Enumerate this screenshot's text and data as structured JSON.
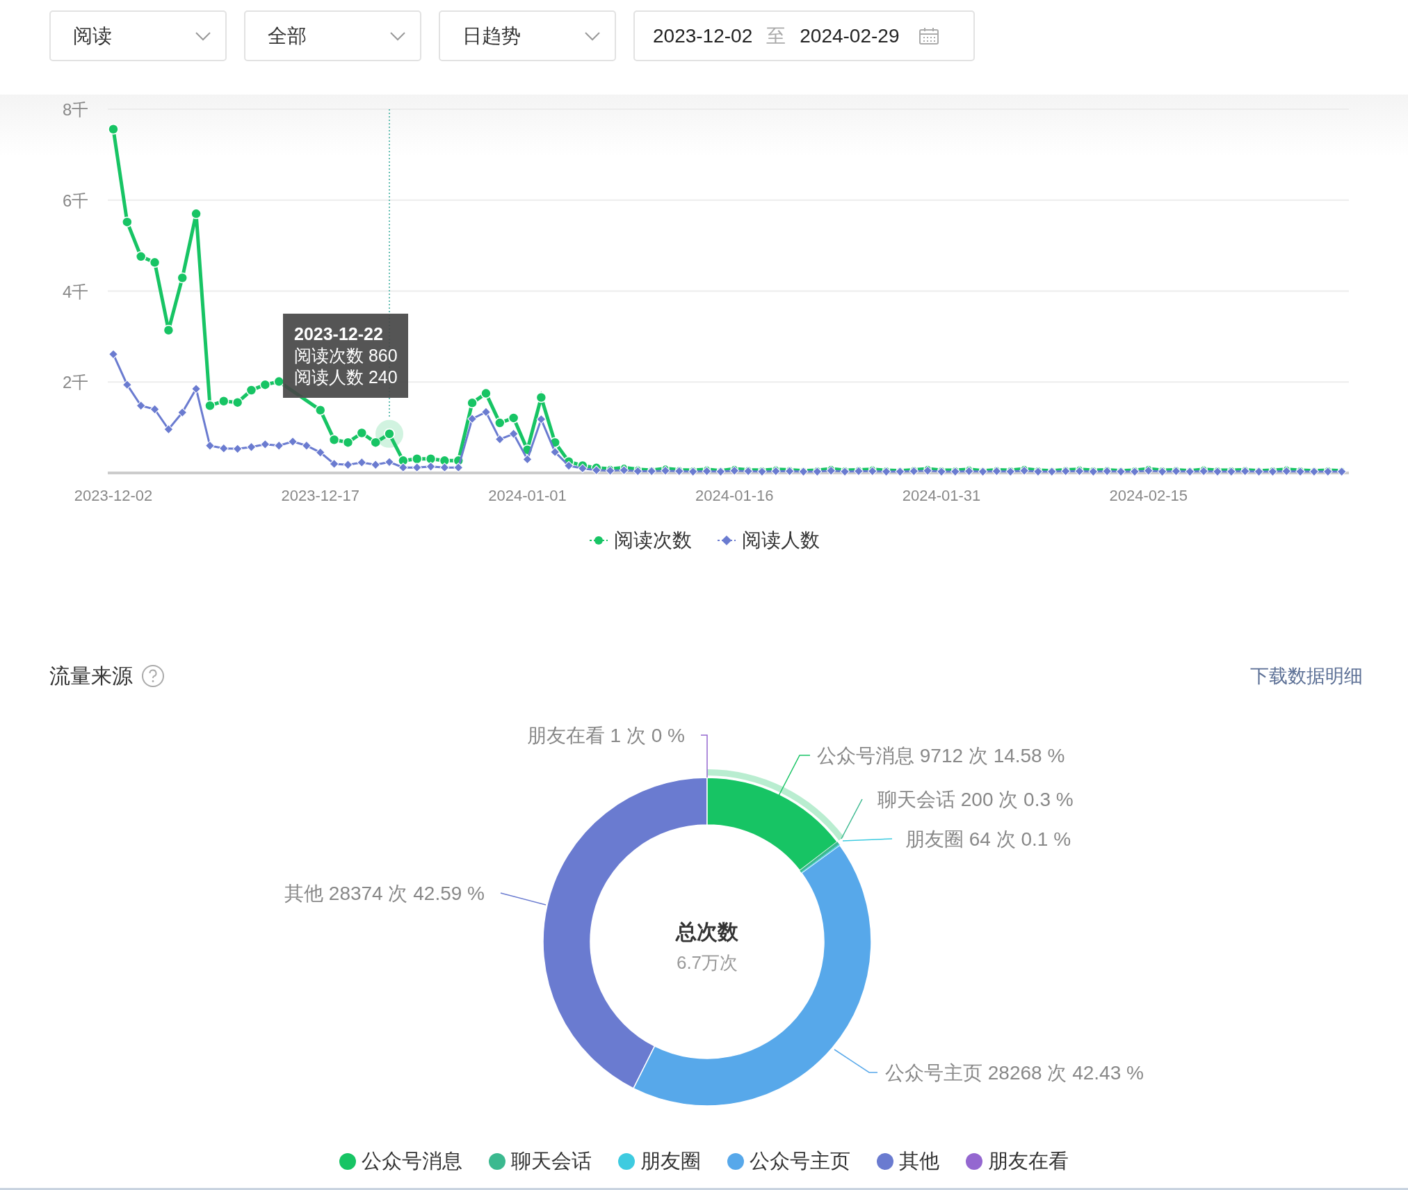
{
  "filters": [
    {
      "value": "阅读"
    },
    {
      "value": "全部"
    },
    {
      "value": "日趋势"
    }
  ],
  "date_range": {
    "start": "2023-12-02",
    "separator": "至",
    "end": "2024-02-29"
  },
  "trend_chart": {
    "chart_data": {
      "type": "line",
      "grid": true,
      "ylim": [
        0,
        8
      ],
      "yticks": [
        {
          "value": 2,
          "label": "2千"
        },
        {
          "value": 4,
          "label": "4千"
        },
        {
          "value": 6,
          "label": "6千"
        },
        {
          "value": 8,
          "label": "8千"
        }
      ],
      "categories": [
        "2023-12-02",
        null,
        null,
        null,
        null,
        null,
        null,
        null,
        null,
        null,
        null,
        null,
        null,
        null,
        null,
        "2023-12-17",
        null,
        null,
        null,
        null,
        null,
        null,
        null,
        null,
        null,
        null,
        null,
        null,
        null,
        null,
        "2024-01-01",
        null,
        null,
        null,
        null,
        null,
        null,
        null,
        null,
        null,
        null,
        null,
        null,
        null,
        null,
        "2024-01-16",
        null,
        null,
        null,
        null,
        null,
        null,
        null,
        null,
        null,
        null,
        null,
        null,
        null,
        null,
        "2024-01-31",
        null,
        null,
        null,
        null,
        null,
        null,
        null,
        null,
        null,
        null,
        null,
        null,
        null,
        null,
        "2024-02-15",
        null,
        null,
        null,
        null,
        null,
        null,
        null,
        null,
        null,
        null,
        null,
        null,
        null,
        null
      ],
      "series": [
        {
          "name": "阅读次数",
          "color": "#17c464",
          "marker": "circle",
          "values": [
            7.56,
            5.52,
            4.76,
            4.63,
            3.14,
            4.29,
            5.7,
            1.48,
            1.58,
            1.55,
            1.82,
            1.94,
            2.01,
            null,
            null,
            1.38,
            0.73,
            0.67,
            0.88,
            0.67,
            0.86,
            0.27,
            0.31,
            0.31,
            0.27,
            0.27,
            1.54,
            1.75,
            1.1,
            1.21,
            0.51,
            1.66,
            0.67,
            0.25,
            0.16,
            0.11,
            0.09,
            0.12,
            0.08,
            0.06,
            0.1,
            0.07,
            0.06,
            0.08,
            0.05,
            0.09,
            0.07,
            0.06,
            0.08,
            0.07,
            0.05,
            0.06,
            0.09,
            0.06,
            0.07,
            0.08,
            0.06,
            0.05,
            0.07,
            0.09,
            0.06,
            0.06,
            0.08,
            0.05,
            0.07,
            0.06,
            0.09,
            0.06,
            0.05,
            0.07,
            0.08,
            0.06,
            0.07,
            0.05,
            0.06,
            0.09,
            0.06,
            0.07,
            0.05,
            0.08,
            0.06,
            0.06,
            0.07,
            0.05,
            0.06,
            0.08,
            0.06,
            0.05,
            0.06,
            0.05
          ]
        },
        {
          "name": "阅读人数",
          "color": "#6a7bd0",
          "marker": "diamond",
          "values": [
            2.61,
            1.94,
            1.48,
            1.4,
            0.96,
            1.33,
            1.85,
            0.6,
            0.54,
            0.53,
            0.57,
            0.63,
            0.6,
            0.69,
            0.6,
            0.45,
            0.2,
            0.18,
            0.23,
            0.18,
            0.24,
            0.12,
            0.12,
            0.14,
            0.12,
            0.12,
            1.19,
            1.34,
            0.74,
            0.86,
            0.3,
            1.18,
            0.46,
            0.16,
            0.1,
            0.06,
            0.05,
            0.06,
            0.04,
            0.04,
            0.05,
            0.04,
            0.03,
            0.04,
            0.03,
            0.05,
            0.04,
            0.03,
            0.04,
            0.04,
            0.03,
            0.03,
            0.05,
            0.03,
            0.04,
            0.04,
            0.03,
            0.03,
            0.04,
            0.05,
            0.03,
            0.03,
            0.04,
            0.03,
            0.04,
            0.03,
            0.05,
            0.03,
            0.03,
            0.04,
            0.04,
            0.03,
            0.04,
            0.03,
            0.03,
            0.05,
            0.03,
            0.04,
            0.03,
            0.04,
            0.03,
            0.03,
            0.04,
            0.03,
            0.03,
            0.04,
            0.03,
            0.03,
            0.03,
            0.03
          ]
        }
      ]
    },
    "tooltip": {
      "date": "2023-12-22",
      "rows": [
        "阅读次数 860",
        "阅读人数 240"
      ]
    }
  },
  "traffic_section": {
    "title": "流量来源",
    "download_link": "下载数据明细",
    "chart_data": {
      "type": "donut",
      "categories": [
        "公众号消息",
        "聊天会话",
        "朋友圈",
        "公众号主页",
        "其他",
        "朋友在看"
      ],
      "values": [
        14.58,
        0.3,
        0.1,
        42.43,
        42.59,
        0
      ],
      "colors": [
        "#17c464",
        "#3bb98f",
        "#3ecbe0",
        "#57a8ea",
        "#6a7bd0",
        "#9467d0"
      ]
    },
    "slice_labels": [
      {
        "count": "9712 次",
        "share": "14.58 %",
        "emphasized": true
      },
      {
        "count": "200 次",
        "share": "0.3 %",
        "emphasized": false
      },
      {
        "count": "64 次",
        "share": "0.1 %",
        "emphasized": false
      },
      {
        "count": "28268 次",
        "share": "42.43 %",
        "emphasized": false
      },
      {
        "count": "28374 次",
        "share": "42.59 %",
        "emphasized": false
      },
      {
        "count": "1 次",
        "share": "0 %",
        "emphasized": false
      }
    ],
    "center_title": "总次数",
    "center_value": "6.7万次",
    "legend": [
      {
        "label": "公众号消息",
        "color": "#17c464"
      },
      {
        "label": "聊天会话",
        "color": "#3bb98f"
      },
      {
        "label": "朋友圈",
        "color": "#3ecbe0"
      },
      {
        "label": "公众号主页",
        "color": "#57a8ea"
      },
      {
        "label": "其他",
        "color": "#6a7bd0"
      },
      {
        "label": "朋友在看",
        "color": "#9467d0"
      }
    ]
  }
}
